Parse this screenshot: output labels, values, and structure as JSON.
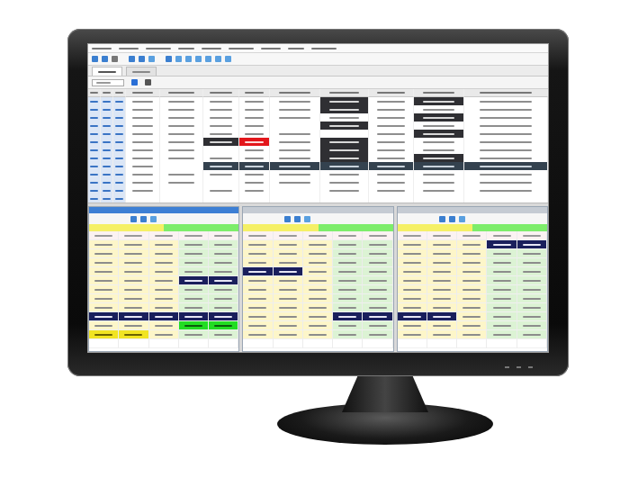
{
  "menu_bar": {
    "items": [
      {
        "disabled": false
      },
      {
        "disabled": false
      },
      {
        "disabled": false
      },
      {
        "disabled": false
      },
      {
        "disabled": false
      },
      {
        "disabled": false
      },
      {
        "disabled": false
      },
      {
        "disabled": false
      },
      {
        "disabled": false
      }
    ]
  },
  "toolbar": {
    "buttons": [
      {
        "color": "#3b7fd0"
      },
      {
        "color": "#3b7fd0"
      },
      {
        "color": "#777777"
      },
      {
        "color": "#3b7fd0"
      },
      {
        "color": "#3b7fd0"
      },
      {
        "color": "#5aa0e0"
      },
      {
        "color": "#3b7fd0"
      },
      {
        "color": "#5aa0e0"
      },
      {
        "color": "#5aa0e0"
      },
      {
        "color": "#5aa0e0"
      },
      {
        "color": "#5aa0e0"
      },
      {
        "color": "#5aa0e0"
      },
      {
        "color": "#5aa0e0"
      }
    ]
  },
  "tabs": [
    {
      "selected": true
    },
    {
      "selected": false
    }
  ],
  "filter": {
    "buttons": [
      {
        "color": "#2a6fd6"
      },
      {
        "color": "#555555"
      }
    ]
  },
  "top_table": {
    "columns": 12,
    "rows": [
      {
        "cells": [
          "key",
          "key",
          "key",
          "text",
          "text",
          "text",
          "text",
          "text",
          "dark",
          "text",
          "dark",
          "text"
        ]
      },
      {
        "cells": [
          "key",
          "key",
          "key",
          "text",
          "text",
          "text",
          "text",
          "text",
          "dark",
          "text",
          "text",
          "text"
        ]
      },
      {
        "cells": [
          "key",
          "key",
          "key",
          "text",
          "text",
          "text",
          "text",
          "text",
          "text",
          "text",
          "dark",
          "text"
        ]
      },
      {
        "cells": [
          "key",
          "key",
          "key",
          "text",
          "text",
          "text",
          "text",
          "empty",
          "dark",
          "text",
          "text",
          "text"
        ]
      },
      {
        "cells": [
          "key",
          "key",
          "key",
          "text",
          "text",
          "text",
          "text",
          "text",
          "empty",
          "text",
          "dark",
          "text"
        ]
      },
      {
        "cells": [
          "key",
          "key",
          "key",
          "text",
          "text",
          "dark",
          "red",
          "text",
          "dark",
          "text",
          "text",
          "text"
        ]
      },
      {
        "cells": [
          "key",
          "key",
          "key",
          "text",
          "text",
          "empty",
          "text",
          "text",
          "dark",
          "text",
          "text",
          "text"
        ]
      },
      {
        "cells": [
          "key",
          "key",
          "key",
          "text",
          "text",
          "text",
          "text",
          "text",
          "dark",
          "text",
          "dark",
          "text"
        ]
      },
      {
        "cells": [
          "key",
          "key",
          "key",
          "text",
          "empty",
          "band",
          "band",
          "band",
          "band",
          "band",
          "band",
          "band"
        ]
      },
      {
        "cells": [
          "key",
          "key",
          "key",
          "text",
          "text",
          "text",
          "text",
          "text",
          "text",
          "text",
          "text",
          "text"
        ]
      },
      {
        "cells": [
          "key",
          "key",
          "key",
          "text",
          "text",
          "empty",
          "text",
          "text",
          "text",
          "text",
          "text",
          "text"
        ]
      },
      {
        "cells": [
          "key",
          "key",
          "key",
          "text",
          "empty",
          "text",
          "text",
          "empty",
          "text",
          "text",
          "text",
          "text"
        ]
      },
      {
        "cells": [
          "key",
          "key",
          "key",
          "empty",
          "empty",
          "empty",
          "empty",
          "empty",
          "empty",
          "empty",
          "empty",
          "empty"
        ]
      }
    ]
  },
  "panels": [
    {
      "selected": true,
      "tools": [
        {
          "color": "#3b7fd0"
        },
        {
          "color": "#3b7fd0"
        },
        {
          "color": "#5aa0e0"
        }
      ],
      "strip": [
        {
          "color": "#f5f066"
        },
        {
          "color": "#7ded6b"
        }
      ],
      "rows": [
        {
          "cells": [
            "bid",
            "bid",
            "bid",
            "ask",
            "ask"
          ]
        },
        {
          "cells": [
            "bid",
            "bid",
            "bid",
            "ask",
            "ask"
          ]
        },
        {
          "cells": [
            "bid",
            "bid",
            "bid",
            "ask",
            "ask"
          ]
        },
        {
          "cells": [
            "bid",
            "bid",
            "bid",
            "ask",
            "ask"
          ]
        },
        {
          "cells": [
            "bid",
            "bid",
            "bid",
            "navy",
            "navy"
          ]
        },
        {
          "cells": [
            "bid",
            "bid",
            "bid",
            "ask",
            "ask"
          ]
        },
        {
          "cells": [
            "bid",
            "bid",
            "bid",
            "ask",
            "ask"
          ]
        },
        {
          "cells": [
            "bid",
            "bid",
            "bid",
            "ask",
            "ask"
          ]
        },
        {
          "cells": [
            "navy",
            "navy",
            "navy",
            "navy",
            "navy"
          ]
        },
        {
          "cells": [
            "bid",
            "bid",
            "bid",
            "lime",
            "lime"
          ]
        },
        {
          "cells": [
            "gold",
            "gold",
            "bid",
            "ask",
            "ask"
          ]
        },
        {
          "cells": [
            "blank",
            "blank",
            "blank",
            "blank",
            "blank"
          ]
        }
      ]
    },
    {
      "selected": false,
      "tools": [
        {
          "color": "#3b7fd0"
        },
        {
          "color": "#3b7fd0"
        },
        {
          "color": "#5aa0e0"
        }
      ],
      "strip": [
        {
          "color": "#f5f066"
        },
        {
          "color": "#7ded6b"
        }
      ],
      "rows": [
        {
          "cells": [
            "bid",
            "bid",
            "bid",
            "ask",
            "ask"
          ]
        },
        {
          "cells": [
            "bid",
            "bid",
            "bid",
            "ask",
            "ask"
          ]
        },
        {
          "cells": [
            "bid",
            "bid",
            "bid",
            "ask",
            "ask"
          ]
        },
        {
          "cells": [
            "navy",
            "navy",
            "bid",
            "ask",
            "ask"
          ]
        },
        {
          "cells": [
            "bid",
            "bid",
            "bid",
            "ask",
            "ask"
          ]
        },
        {
          "cells": [
            "bid",
            "bid",
            "bid",
            "ask",
            "ask"
          ]
        },
        {
          "cells": [
            "bid",
            "bid",
            "bid",
            "ask",
            "ask"
          ]
        },
        {
          "cells": [
            "bid",
            "bid",
            "bid",
            "ask",
            "ask"
          ]
        },
        {
          "cells": [
            "bid",
            "bid",
            "bid",
            "navy",
            "navy"
          ]
        },
        {
          "cells": [
            "bid",
            "bid",
            "bid",
            "ask",
            "ask"
          ]
        },
        {
          "cells": [
            "bid",
            "bid",
            "bid",
            "ask",
            "ask"
          ]
        },
        {
          "cells": [
            "blank",
            "blank",
            "blank",
            "blank",
            "blank"
          ]
        }
      ]
    },
    {
      "selected": false,
      "tools": [
        {
          "color": "#3b7fd0"
        },
        {
          "color": "#3b7fd0"
        },
        {
          "color": "#5aa0e0"
        }
      ],
      "strip": [
        {
          "color": "#f5f066"
        },
        {
          "color": "#7ded6b"
        }
      ],
      "rows": [
        {
          "cells": [
            "bid",
            "bid",
            "bid",
            "navy",
            "navy"
          ]
        },
        {
          "cells": [
            "bid",
            "bid",
            "bid",
            "ask",
            "ask"
          ]
        },
        {
          "cells": [
            "bid",
            "bid",
            "bid",
            "ask",
            "ask"
          ]
        },
        {
          "cells": [
            "bid",
            "bid",
            "bid",
            "ask",
            "ask"
          ]
        },
        {
          "cells": [
            "bid",
            "bid",
            "bid",
            "ask",
            "ask"
          ]
        },
        {
          "cells": [
            "bid",
            "bid",
            "bid",
            "ask",
            "ask"
          ]
        },
        {
          "cells": [
            "bid",
            "bid",
            "bid",
            "ask",
            "ask"
          ]
        },
        {
          "cells": [
            "bid",
            "bid",
            "bid",
            "ask",
            "ask"
          ]
        },
        {
          "cells": [
            "navy",
            "navy",
            "bid",
            "ask",
            "ask"
          ]
        },
        {
          "cells": [
            "bid",
            "bid",
            "bid",
            "ask",
            "ask"
          ]
        },
        {
          "cells": [
            "bid",
            "bid",
            "bid",
            "ask",
            "ask"
          ]
        },
        {
          "cells": [
            "blank",
            "blank",
            "blank",
            "blank",
            "blank"
          ]
        }
      ]
    }
  ]
}
